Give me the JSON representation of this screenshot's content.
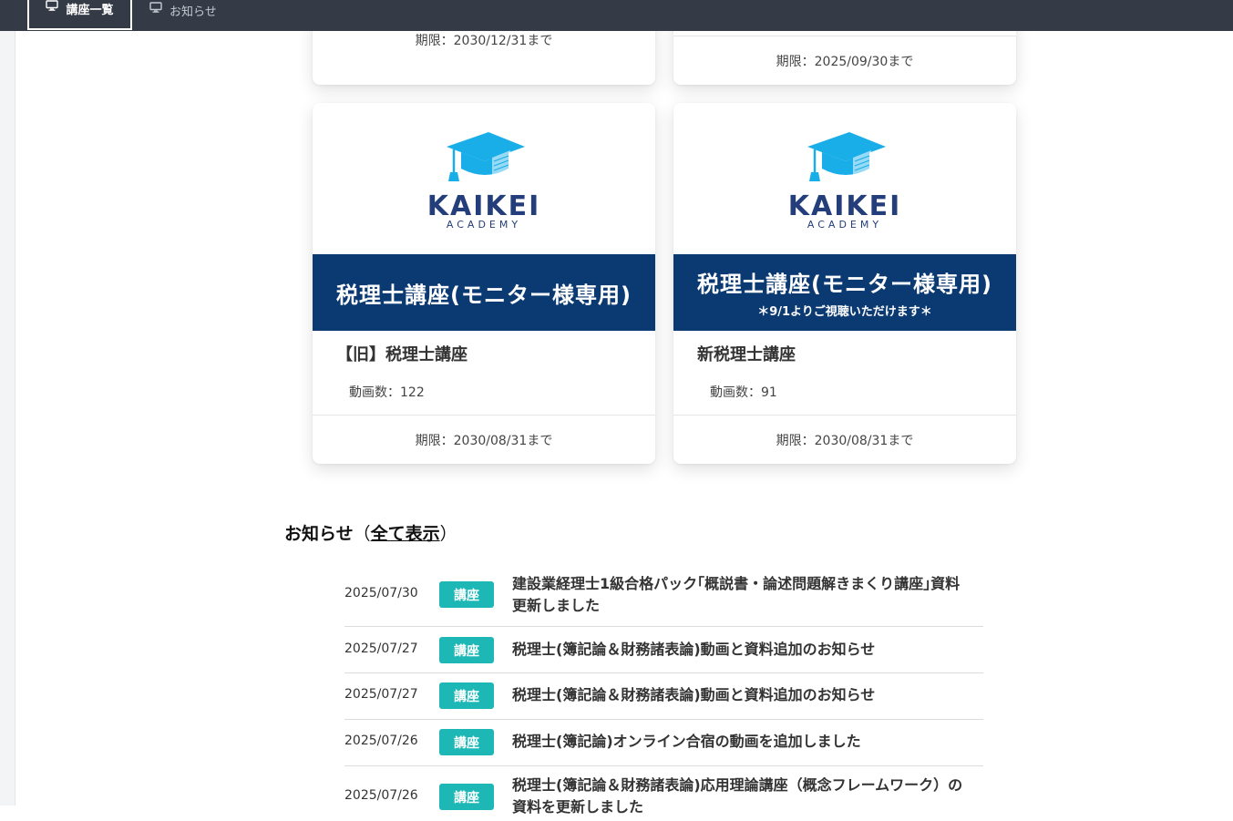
{
  "nav": {
    "tabs": [
      {
        "label": "講座一覧",
        "icon": "monitor-icon",
        "active": true
      },
      {
        "label": "お知らせ",
        "icon": "monitor-icon",
        "active": false
      }
    ]
  },
  "top_cards": [
    {
      "deadline": "期限：2030/12/31まで"
    },
    {
      "deadline": "期限：2025/09/30まで"
    }
  ],
  "cards": [
    {
      "logo_name": "KAIKEI",
      "logo_sub": "ACADEMY",
      "banner_main": "税理士講座(モニター様専用)",
      "banner_sub": "",
      "title": "【旧】税理士講座",
      "video_count": "動画数：122",
      "deadline": "期限：2030/08/31まで"
    },
    {
      "logo_name": "KAIKEI",
      "logo_sub": "ACADEMY",
      "banner_main": "税理士講座(モニター様専用)",
      "banner_sub": "＊9/1よりご視聴いただけます＊",
      "title": "新税理士講座",
      "video_count": "動画数：91",
      "deadline": "期限：2030/08/31まで"
    }
  ],
  "news": {
    "heading": "お知らせ",
    "paren_open": "（",
    "view_all": "全て表示",
    "paren_close": "）",
    "items": [
      {
        "date": "2025/07/30",
        "badge": "講座",
        "title": "建設業経理士1級合格パック｢概説書・論述問題解きまくり講座｣資料更新しました"
      },
      {
        "date": "2025/07/27",
        "badge": "講座",
        "title": "税理士(簿記論＆財務諸表論)動画と資料追加のお知らせ"
      },
      {
        "date": "2025/07/27",
        "badge": "講座",
        "title": "税理士(簿記論＆財務諸表論)動画と資料追加のお知らせ"
      },
      {
        "date": "2025/07/26",
        "badge": "講座",
        "title": "税理士(簿記論)オンライン合宿の動画を追加しました"
      },
      {
        "date": "2025/07/26",
        "badge": "講座",
        "title": "税理士(簿記論＆財務諸表論)応用理論講座（概念フレームワーク）の資料を更新しました"
      }
    ]
  },
  "colors": {
    "nav_bg": "#343a46",
    "banner_bg": "#0b3a72",
    "badge_bg": "#1db7b5",
    "logo_cap": "#1aaee8",
    "logo_text": "#233e7a"
  }
}
